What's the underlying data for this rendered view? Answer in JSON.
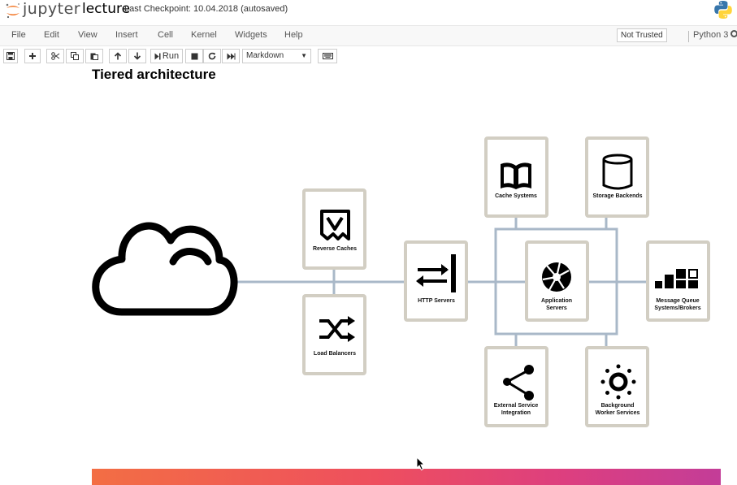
{
  "header": {
    "logo_text": "jupyter",
    "notebook_name": "lecture",
    "checkpoint": "Last Checkpoint: 10.04.2018   (autosaved)"
  },
  "menu": {
    "items": [
      "File",
      "Edit",
      "View",
      "Insert",
      "Cell",
      "Kernel",
      "Widgets",
      "Help"
    ],
    "trust_status": "Not Trusted",
    "kernel": "Python 3"
  },
  "toolbar": {
    "run_label": "Run",
    "cell_type": "Markdown",
    "icons": [
      "save-icon",
      "plus-icon",
      "scissors-icon",
      "copy-icon",
      "paste-icon",
      "arrow-up-icon",
      "arrow-down-icon",
      "step-forward-icon",
      "stop-icon",
      "restart-icon",
      "fast-forward-icon",
      "keyboard-icon"
    ]
  },
  "content": {
    "heading": "Tiered architecture",
    "diagram": {
      "nodes": {
        "reverse_caches": "Reverse Caches",
        "load_balancers": "Load Balancers",
        "http_servers": "HTTP Servers",
        "cache_systems": "Cache Systems",
        "storage_backends": "Storage Backends",
        "application_servers_1": "Application",
        "application_servers_2": "Servers",
        "message_queue_1": "Message Queue",
        "message_queue_2": "Systems/Brokers",
        "external_service_1": "External Service",
        "external_service_2": "Integration",
        "background_worker_1": "Background",
        "background_worker_2": "Worker Services"
      },
      "colors": {
        "connector": "#a9b8c8",
        "tile_border": "#d2cec3",
        "tile_bg": "#ffffff"
      }
    }
  }
}
